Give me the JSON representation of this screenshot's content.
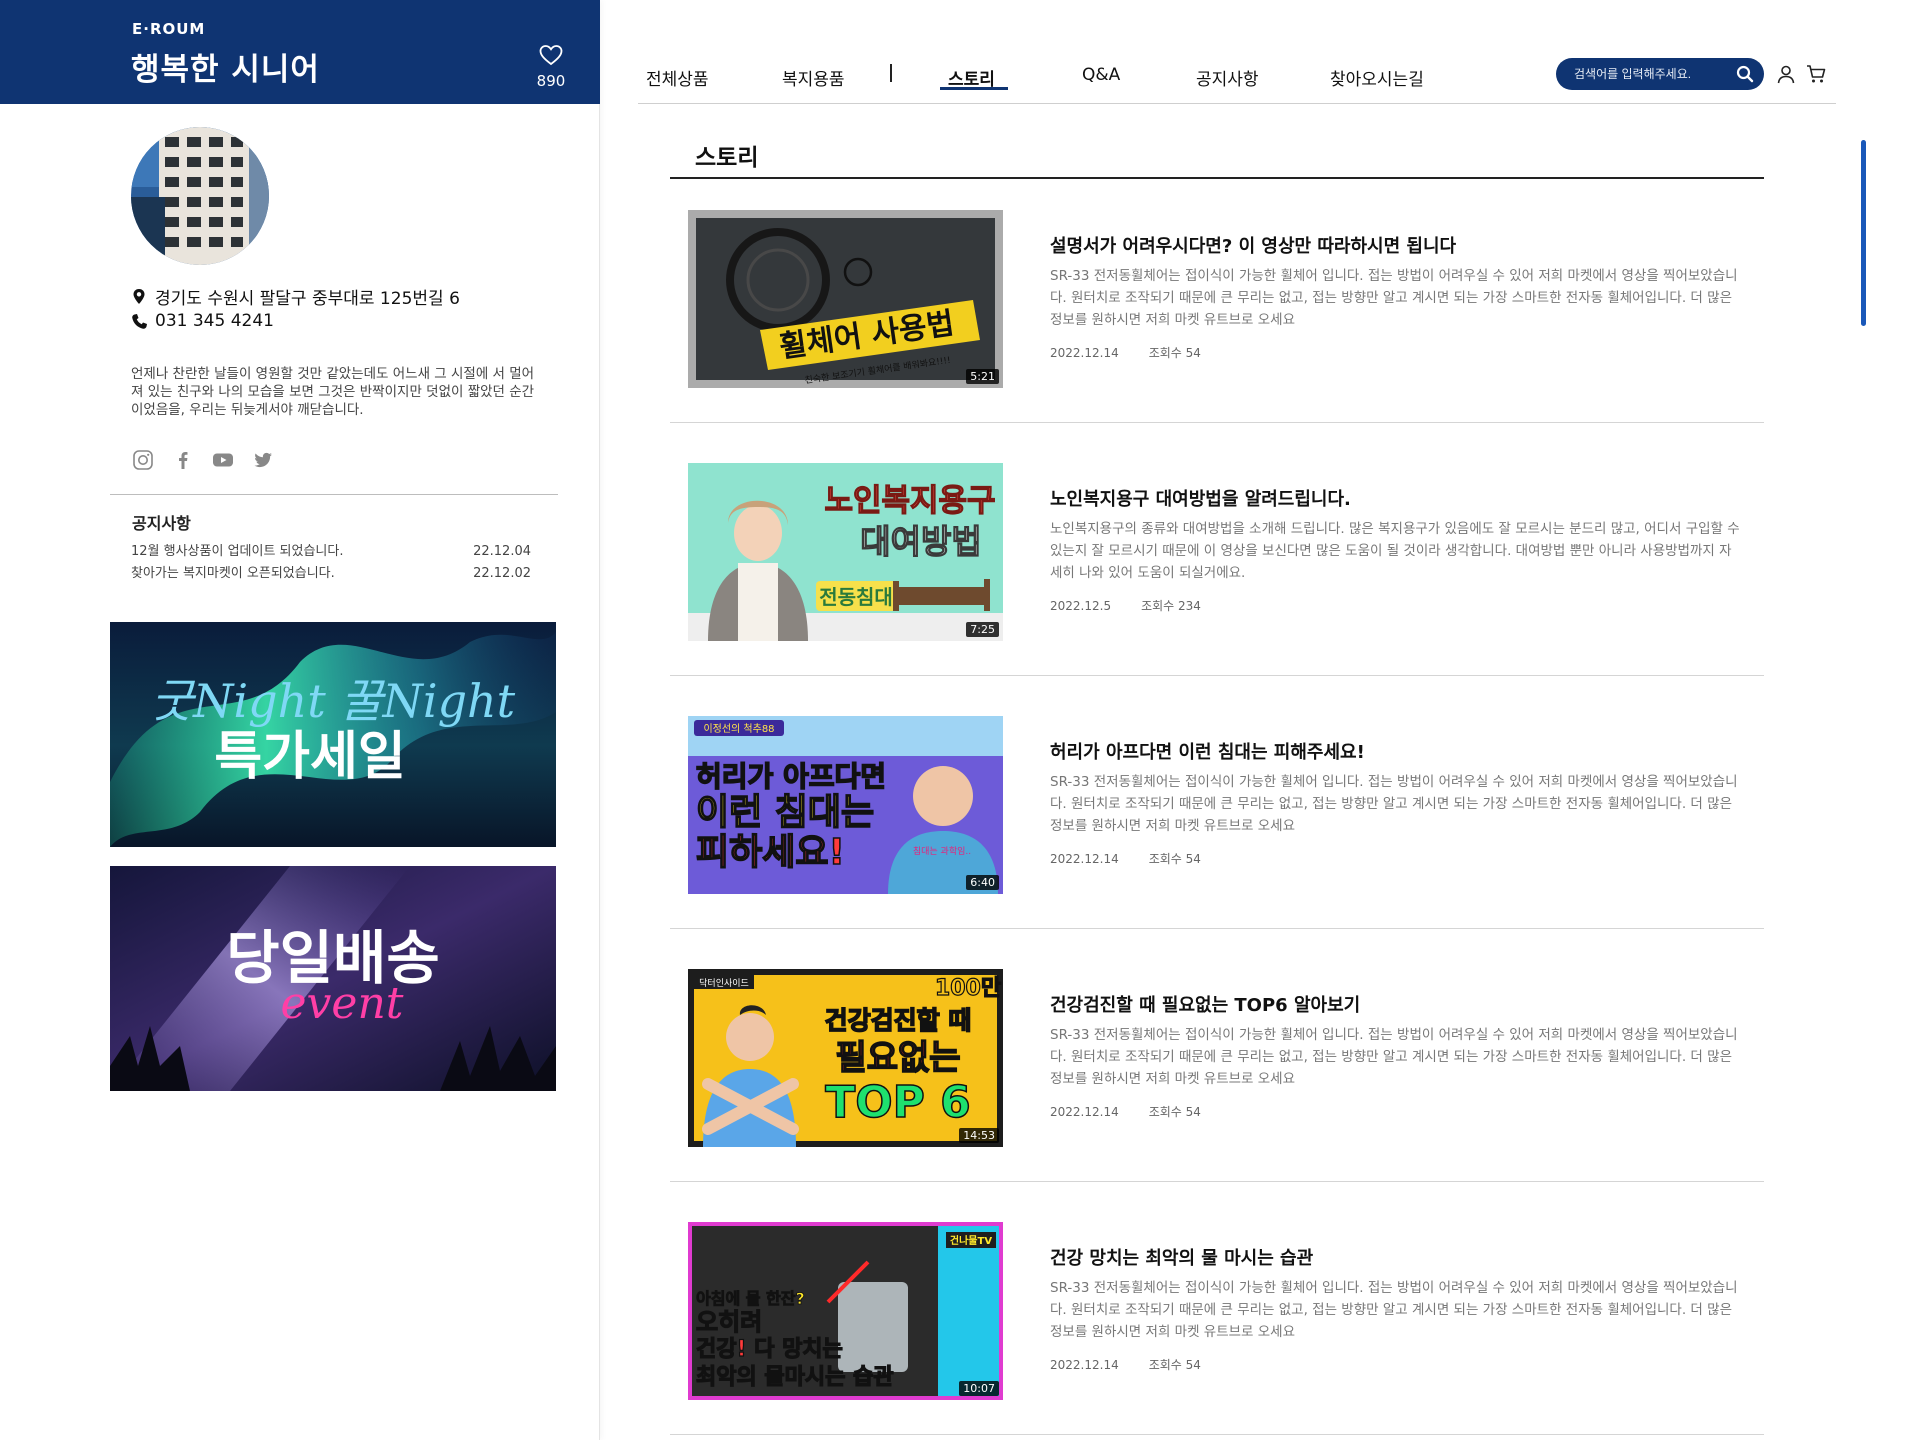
{
  "brand": {
    "logo": "E·ROUM",
    "title": "행복한 시니어",
    "likes": "890"
  },
  "profile": {
    "address": "경기도 수원시 팔달구 중부대로 125번길 6",
    "phone": "031 345 4241",
    "intro": "언제나 찬란한 날들이 영원할 것만 같았는데도 어느새 그 시절에 서 멀어져 있는 친구와 나의 모습을 보면 그것은 반짝이지만 덧없이 짧았던 순간이었음을, 우리는 뒤늦게서야 깨닫습니다.",
    "social_icons": [
      "instagram-icon",
      "facebook-icon",
      "youtube-icon",
      "twitter-icon"
    ]
  },
  "notice": {
    "title": "공지사항",
    "items": [
      {
        "text": "12월 행사상품이 업데이트 되었습니다.",
        "date": "22.12.04"
      },
      {
        "text": "찾아가는 복지마켓이 오픈되었습니다.",
        "date": "22.12.02"
      }
    ]
  },
  "banners": [
    {
      "title": "굿Night 꿀Night",
      "subtitle": "특가세일"
    },
    {
      "title": "당일배송",
      "subtitle": "event"
    }
  ],
  "nav": {
    "items": [
      "전체상품",
      "복지용품",
      "스토리",
      "Q&A",
      "공지사항",
      "찾아오시는길"
    ],
    "active": "스토리"
  },
  "search": {
    "placeholder": "검색어를 입력해주세요."
  },
  "section_title": "스토리",
  "stories": [
    {
      "title": "설명서가 어려우시다면? 이 영상만 따라하시면 됩니다",
      "desc": "SR-33 전저동휠체어는 접이식이 가능한 휠체어 입니다. 접는 방법이 어려우실 수 있어 저희 마켓에서 영상을 찍어보았습니다. 원터치로 조작되기 때문에 큰 무리는 없고, 접는 방향만 알고 계시면 되는 가장 스마트한 전자동 휠체어입니다. 더 많은 정보를 원하시면 저희 마켓 유트브로 오세요",
      "date": "2022.12.14",
      "views": "조회수 54",
      "duration": "5:21",
      "thumb_text": [
        "휠체어 사용법",
        "친숙한 보조기기 휠체어를 배워봐요!!!!"
      ]
    },
    {
      "title": "노인복지용구 대여방법을 알려드립니다.",
      "desc": "노인복지용구의 종류와 대여방법을 소개해 드립니다. 많은 복지용구가 있음에도 잘 모르시는 분드리 많고, 어디서 구입할 수 있는지 잘 모르시기 때문에 이 영상을 보신다면 많은 도움이 될 것이라 생각합니다. 대여방법 뿐만 아니라 사용방법까지 자세히 나와 있어 도움이 되실거에요.",
      "date": "2022.12.5",
      "views": "조회수 234",
      "duration": "7:25",
      "thumb_text": [
        "노인복지용구",
        "대여방법",
        "전동침대"
      ]
    },
    {
      "title": "허리가 아프다면 이런 침대는 피해주세요!",
      "desc": "SR-33 전저동휠체어는 접이식이 가능한 휠체어 입니다. 접는 방법이 어려우실 수 있어 저희 마켓에서 영상을 찍어보았습니다. 원터치로 조작되기 때문에 큰 무리는 없고, 접는 방향만 알고 계시면 되는 가장 스마트한 전자동 휠체어입니다. 더 많은 정보를 원하시면 저희 마켓 유트브로 오세요",
      "date": "2022.12.14",
      "views": "조회수 54",
      "duration": "6:40",
      "thumb_text": [
        "이정선의 척추88",
        "허리가 아프다면",
        "이런 침대는",
        "피하세요!",
        "침대는 과학임.."
      ]
    },
    {
      "title": "건강검진할 때 필요없는 TOP6 알아보기",
      "desc": "SR-33 전저동휠체어는 접이식이 가능한 휠체어 입니다. 접는 방법이 어려우실 수 있어 저희 마켓에서 영상을 찍어보았습니다. 원터치로 조작되기 때문에 큰 무리는 없고, 접는 방향만 알고 계시면 되는 가장 스마트한 전자동 휠체어입니다. 더 많은 정보를 원하시면 저희 마켓 유트브로 오세요",
      "date": "2022.12.14",
      "views": "조회수 54",
      "duration": "14:53",
      "thumb_text": [
        "닥터인사이드",
        "100만",
        "건강검진할 때",
        "필요없는",
        "TOP 6"
      ]
    },
    {
      "title": "건강 망치는 최악의 물 마시는 습관",
      "desc": "SR-33 전저동휠체어는 접이식이 가능한 휠체어 입니다. 접는 방법이 어려우실 수 있어 저희 마켓에서 영상을 찍어보았습니다. 원터치로 조작되기 때문에 큰 무리는 없고, 접는 방향만 알고 계시면 되는 가장 스마트한 전자동 휠체어입니다. 더 많은 정보를 원하시면 저희 마켓 유트브로 오세요",
      "date": "2022.12.14",
      "views": "조회수 54",
      "duration": "10:07",
      "thumb_text": [
        "건나물TV",
        "아침에 물 한잔?",
        "오히려",
        "건강! 다 망치는",
        "최악의 물마시는 습관"
      ]
    }
  ],
  "colors": {
    "brand_navy": "#0f3472",
    "accent_blue": "#1a58b9"
  }
}
